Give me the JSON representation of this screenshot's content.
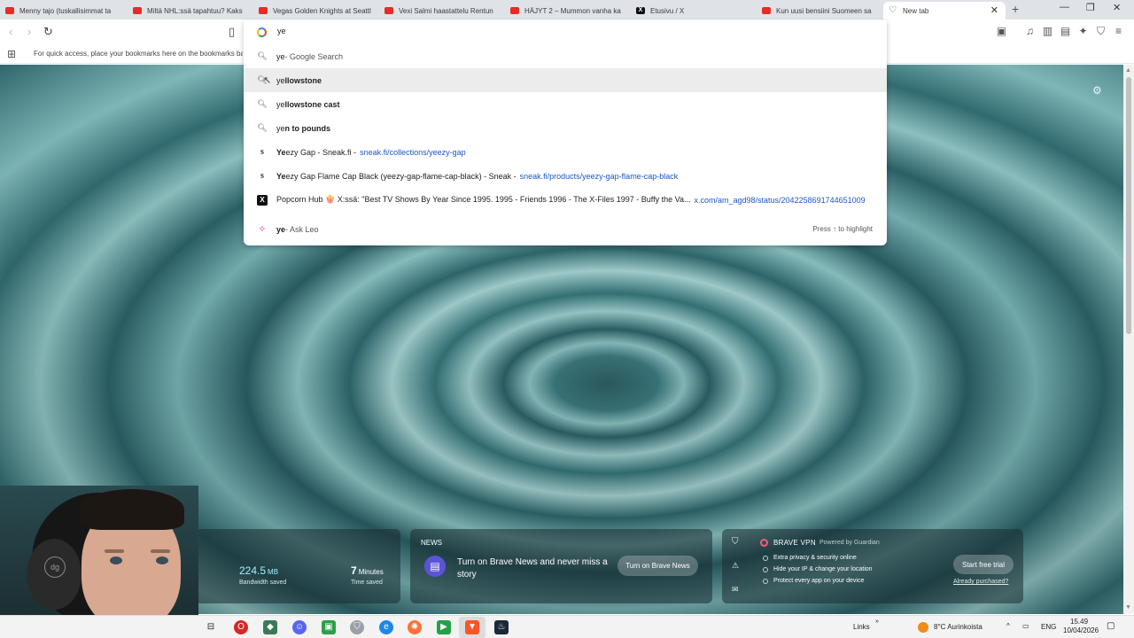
{
  "tabs": [
    {
      "title": "Menny tajo (tuskallisimmat ta",
      "icon": "youtube-icon"
    },
    {
      "title": "Miltä NHL:ssä tapahtuu? Kaks",
      "icon": "youtube-icon"
    },
    {
      "title": "Vegas Golden Knights at Seattl",
      "icon": "youtube-icon"
    },
    {
      "title": "Vexi Salmi haastattelu Rentun",
      "icon": "youtube-icon"
    },
    {
      "title": "HÄJYT 2 – Mummon vanha ka",
      "icon": "youtube-icon"
    },
    {
      "title": "Etusivu / X",
      "icon": "x-icon"
    },
    {
      "title": "Kun uusi bensiini Suomeen sa",
      "icon": "youtube-icon"
    },
    {
      "title": "New tab",
      "icon": "brave-icon"
    }
  ],
  "bookmarks_bar": {
    "hint": "For quick access, place your bookmarks here on the bookmarks bar."
  },
  "omnibox": {
    "query": "ye",
    "suggestions": [
      {
        "typed": "ye",
        "rest": "",
        "suffix": " - Google Search",
        "url": "",
        "icon": "search-icon"
      },
      {
        "typed": "ye",
        "rest": "llowstone",
        "suffix": "",
        "url": "",
        "icon": "search-icon"
      },
      {
        "typed": "ye",
        "rest": "llowstone cast",
        "suffix": "",
        "url": "",
        "icon": "search-icon"
      },
      {
        "typed": "ye",
        "rest": "n to pounds",
        "suffix": "",
        "url": "",
        "icon": "search-icon"
      },
      {
        "typed": "Ye",
        "rest": "ezy Gap - Sneak.fi - ",
        "suffix": "",
        "url": "sneak.fi/collections/yeezy-gap",
        "icon": "sneak-icon"
      },
      {
        "typed": "Ye",
        "rest": "ezy Gap Flame Cap Black (yeezy-gap-flame-cap-black) - Sneak - ",
        "suffix": "",
        "url": "sneak.fi/products/yeezy-gap-flame-cap-black",
        "icon": "sneak-icon"
      },
      {
        "typed": "",
        "rest": "Popcorn Hub 🍿 X:ssä: \"Best TV Shows By Year Since 1995. 1995 - Friends 1996 - The X-Files 1997 - Buffy the Va...",
        "suffix": "",
        "url": "x.com/am_agd98/status/2042258691744651009",
        "icon": "x-icon"
      }
    ],
    "leo": {
      "typed": "ye",
      "suffix": " - Ask Leo",
      "hint": "Press ↑ to highlight"
    }
  },
  "widgets": {
    "stats": {
      "bandwidth_value": "224.5",
      "bandwidth_unit": "MB",
      "bandwidth_label": "Bandwidth saved",
      "time_value": "7",
      "time_unit": "Minutes",
      "time_label": "Time saved"
    },
    "news": {
      "heading": "NEWS",
      "text": "Turn on Brave News and never miss a story",
      "button": "Turn on Brave News"
    },
    "vpn": {
      "title": "BRAVE VPN",
      "powered": "Powered by Guardian",
      "features": [
        "Extra privacy & security online",
        "Hide your IP & change your location",
        "Protect every app on your device"
      ],
      "button": "Start free trial",
      "already": "Already purchased?"
    }
  },
  "taskbar": {
    "links": "Links",
    "weather": "8°C Aurinkoista",
    "lang": "ENG",
    "time": "15.49",
    "date": "10/04/2026"
  },
  "colors": {
    "accent_link": "#1a56c8",
    "youtube_red": "#e52d27",
    "vpn_accent": "#ff5a7a"
  }
}
